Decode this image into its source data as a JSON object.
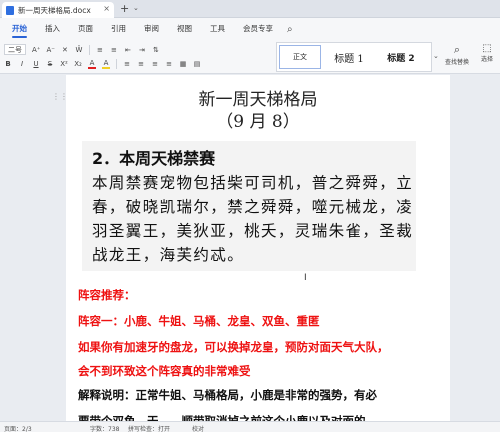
{
  "window": {
    "doc_tab_title": "新一周天梯格局.docx",
    "close_glyph": "×",
    "new_tab_glyph": "+",
    "new_tab_arrow_glyph": "⌄"
  },
  "ribbon": {
    "tabs": [
      "开始",
      "插入",
      "页面",
      "引用",
      "审阅",
      "视图",
      "工具",
      "会员专享"
    ],
    "active_tab": "开始"
  },
  "toolbar": {
    "font_size": "二号",
    "row1_glyphs": [
      "A⁺",
      "A⁻",
      "✕",
      "Ŵ",
      "≡",
      "≡",
      "⇤",
      "⇥",
      "⇅"
    ],
    "row2_glyphs": [
      "B",
      "I",
      "U",
      "S",
      "X²",
      "X₂",
      "A",
      "A",
      "≡",
      "≡",
      "≡",
      "≡",
      "▦",
      "▤"
    ],
    "styles": {
      "normal": "正文",
      "heading1": "标题 1",
      "heading2": "标题 2",
      "more_glyph": "⌄"
    },
    "find_replace": "查找替换",
    "select": "选择"
  },
  "document": {
    "title_line1": "新一周天梯格局",
    "title_line2": "（9 月 8）",
    "section_title": "2．本周天梯禁赛",
    "banned_text": "本周禁赛宠物包括柴可司机，普之舜舜，立春，破晓凯瑞尔，禁之舜舜，噬元械龙，凌羽圣翼王，美狄亚，桃夭，灵瑞朱雀，圣裁战龙王，海芙约忒。",
    "lineup_title": "阵容推荐：",
    "lineup_one": "阵容一：小鹿、牛姐、马桶、龙皇、双鱼、重匿",
    "note_line1": "如果你有加速牙的盘龙，可以换掉龙皇，预防对面天气大队，",
    "note_line2": "会不到环致这个阵容真的非常难受",
    "explain_line": "解释说明：正常牛姐、马桶格局，小鹿是非常的强势，有必",
    "explain_line2": "要带个双鱼，天……顺带取消掉之前这个小鹿以及对面的"
  },
  "statusbar": {
    "page": "页面：2/3",
    "words": "字数：738",
    "spell": "拼写检查：打开",
    "check": "校对"
  }
}
